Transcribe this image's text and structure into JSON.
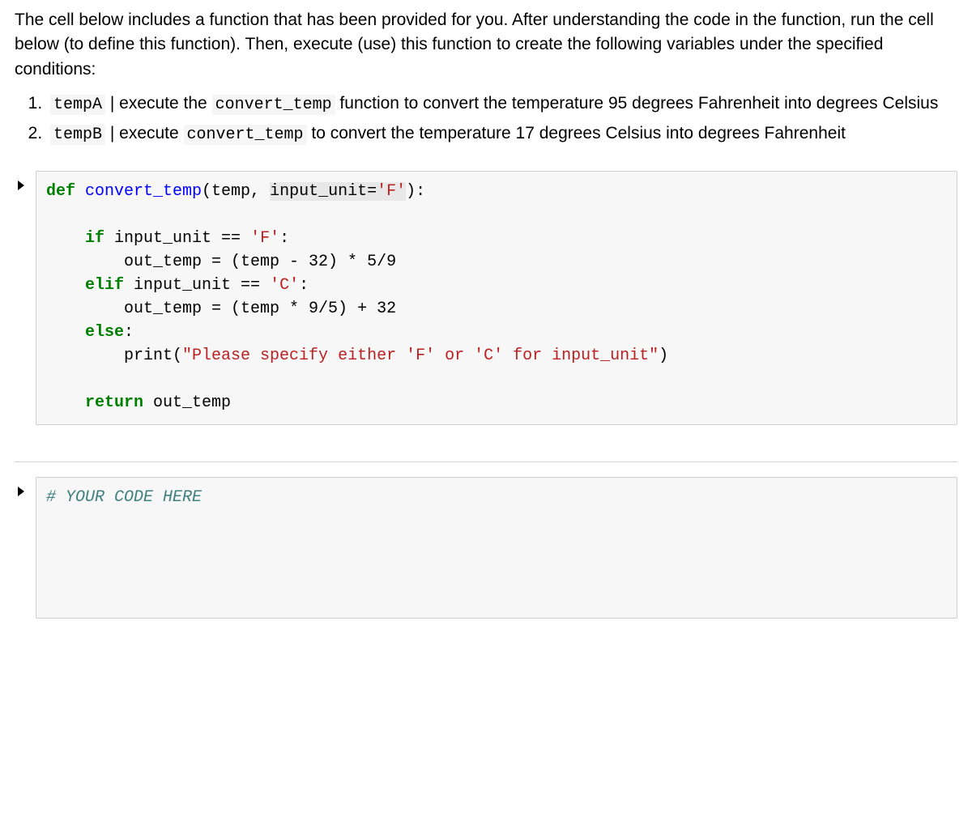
{
  "markdown": {
    "intro": "The cell below includes a function that has been provided for you. After understanding the code in the function, run the cell below (to define this function). Then, execute (use) this function to create the following variables under the specified conditions:",
    "item1_code_a": "tempA",
    "item1_mid": " | execute the ",
    "item1_code_b": "convert_temp",
    "item1_rest": " function to convert the temperature 95 degrees Fahrenheit into degrees Celsius",
    "item2_code_a": "tempB",
    "item2_mid": " | execute ",
    "item2_code_b": "convert_temp",
    "item2_rest": " to convert the temperature 17 degrees Celsius into degrees Fahrenheit"
  },
  "code1": {
    "l1_def": "def",
    "l1_fn": " convert_temp",
    "l1_open": "(temp, ",
    "l1_hl": "input_unit=",
    "l1_str": "'F'",
    "l1_close": "):",
    "l3_if": "if",
    "l3_rest": " input_unit == ",
    "l3_str": "'F'",
    "l3_colon": ":",
    "l4": "        out_temp = (temp - 32) * 5/9",
    "l5_elif": "elif",
    "l5_rest": " input_unit == ",
    "l5_str": "'C'",
    "l5_colon": ":",
    "l6": "        out_temp = (temp * 9/5) + 32",
    "l7_else": "else",
    "l7_colon": ":",
    "l8_pre": "        print(",
    "l8_str": "\"Please specify either 'F' or 'C' for input_unit\"",
    "l8_post": ")",
    "l10_ret": "return",
    "l10_rest": " out_temp"
  },
  "code2": {
    "comment": "# YOUR CODE HERE"
  }
}
